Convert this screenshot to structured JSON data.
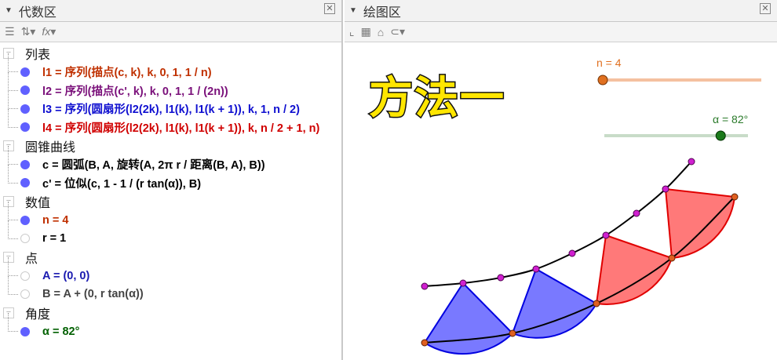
{
  "algebra": {
    "title": "代数区",
    "toolbar": {
      "fx": "fx"
    },
    "groups": [
      {
        "label": "列表",
        "items": [
          {
            "text": "l1 = 序列(描点(c, k), k, 0, 1, 1 / n)",
            "color": "#c03000",
            "visible": true
          },
          {
            "text": "l2 = 序列(描点(c', k), k, 0, 1, 1 / (2n))",
            "color": "#7a107a",
            "visible": true
          },
          {
            "text": "l3 = 序列(圆扇形(l2(2k), l1(k), l1(k + 1)), k, 1, n / 2)",
            "color": "#1010d0",
            "visible": true
          },
          {
            "text": "l4 = 序列(圆扇形(l2(2k), l1(k), l1(k + 1)), k, n / 2 + 1, n)",
            "color": "#d00000",
            "visible": true
          }
        ]
      },
      {
        "label": "圆锥曲线",
        "items": [
          {
            "text": "c = 圆弧(B, A, 旋转(A, 2π r / 距离(B, A), B))",
            "color": "#000000",
            "visible": true
          },
          {
            "text": "c' = 位似(c, 1 - 1 / (r tan(α)), B)",
            "color": "#000000",
            "visible": true
          }
        ]
      },
      {
        "label": "数值",
        "items": [
          {
            "text": "n = 4",
            "color": "#c03000",
            "visible": true
          },
          {
            "text": "r = 1",
            "color": "#000000",
            "visible": false
          }
        ]
      },
      {
        "label": "点",
        "items": [
          {
            "text": "A = (0, 0)",
            "color": "#1a1ab0",
            "visible": false
          },
          {
            "text": "B = A + (0, r tan(α))",
            "color": "#444444",
            "visible": false
          }
        ]
      },
      {
        "label": "角度",
        "items": [
          {
            "text": "α = 82°",
            "color": "#006000",
            "visible": true
          }
        ]
      }
    ]
  },
  "graphics": {
    "title": "绘图区",
    "heading": "方法一",
    "slider_n": {
      "label": "n = 4",
      "value": 4,
      "fraction": 0
    },
    "slider_alpha": {
      "label": "α = 82°",
      "value": 82,
      "fraction": 0.81
    }
  }
}
